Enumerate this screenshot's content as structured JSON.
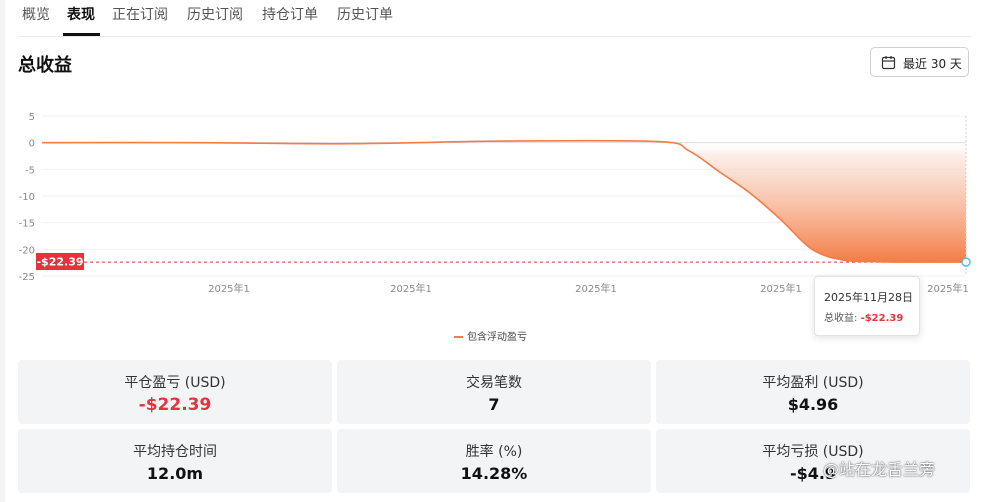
{
  "tabs": [
    {
      "label": "概览",
      "active": false
    },
    {
      "label": "表现",
      "active": true
    },
    {
      "label": "正在订阅",
      "active": false
    },
    {
      "label": "历史订阅",
      "active": false
    },
    {
      "label": "持仓订单",
      "active": false
    },
    {
      "label": "历史订单",
      "active": false
    }
  ],
  "section_title": "总收益",
  "range_button": {
    "label": "最近 30 天",
    "icon": "calendar-icon"
  },
  "chart_data": {
    "type": "area",
    "series": [
      {
        "name": "包含浮动盈亏",
        "color": "#f47c45",
        "x": [
          0,
          5,
          10,
          15,
          20,
          21,
          22,
          23,
          24,
          25,
          26,
          27,
          28,
          29,
          30
        ],
        "values": [
          0,
          0,
          -0.2,
          0.3,
          0.2,
          -1.5,
          -5.5,
          -9.5,
          -14.5,
          -20,
          -22,
          -22.3,
          -22.39,
          -22.39,
          -22.39
        ]
      }
    ],
    "ylim": [
      -25,
      5
    ],
    "yticks": [
      "5",
      "0",
      "-5",
      "-10",
      "-15",
      "-20",
      "-25"
    ],
    "xtick_labels": [
      "2025年1",
      "2025年1",
      "2025年1",
      "2025年1",
      "2025年1"
    ],
    "grid": true,
    "legend_position": "bottom",
    "reference_line": {
      "value": -22.39,
      "label": "-$22.39",
      "color": "#e5323c"
    },
    "tooltip": {
      "date": "2025年11月28日",
      "label": "总收益:",
      "value": "-$22.39"
    }
  },
  "stats": [
    {
      "label": "平仓盈亏 (USD)",
      "value": "-$22.39",
      "negative": true
    },
    {
      "label": "交易笔数",
      "value": "7",
      "negative": false
    },
    {
      "label": "平均盈利 (USD)",
      "value": "$4.96",
      "negative": false
    },
    {
      "label": "平均持仓时间",
      "value": "12.0m",
      "negative": false
    },
    {
      "label": "胜率 (%)",
      "value": "14.28%",
      "negative": false
    },
    {
      "label": "平均亏损 (USD)",
      "value": "-$4.9",
      "negative": false
    }
  ],
  "watermark": "@站在龙舌兰旁"
}
